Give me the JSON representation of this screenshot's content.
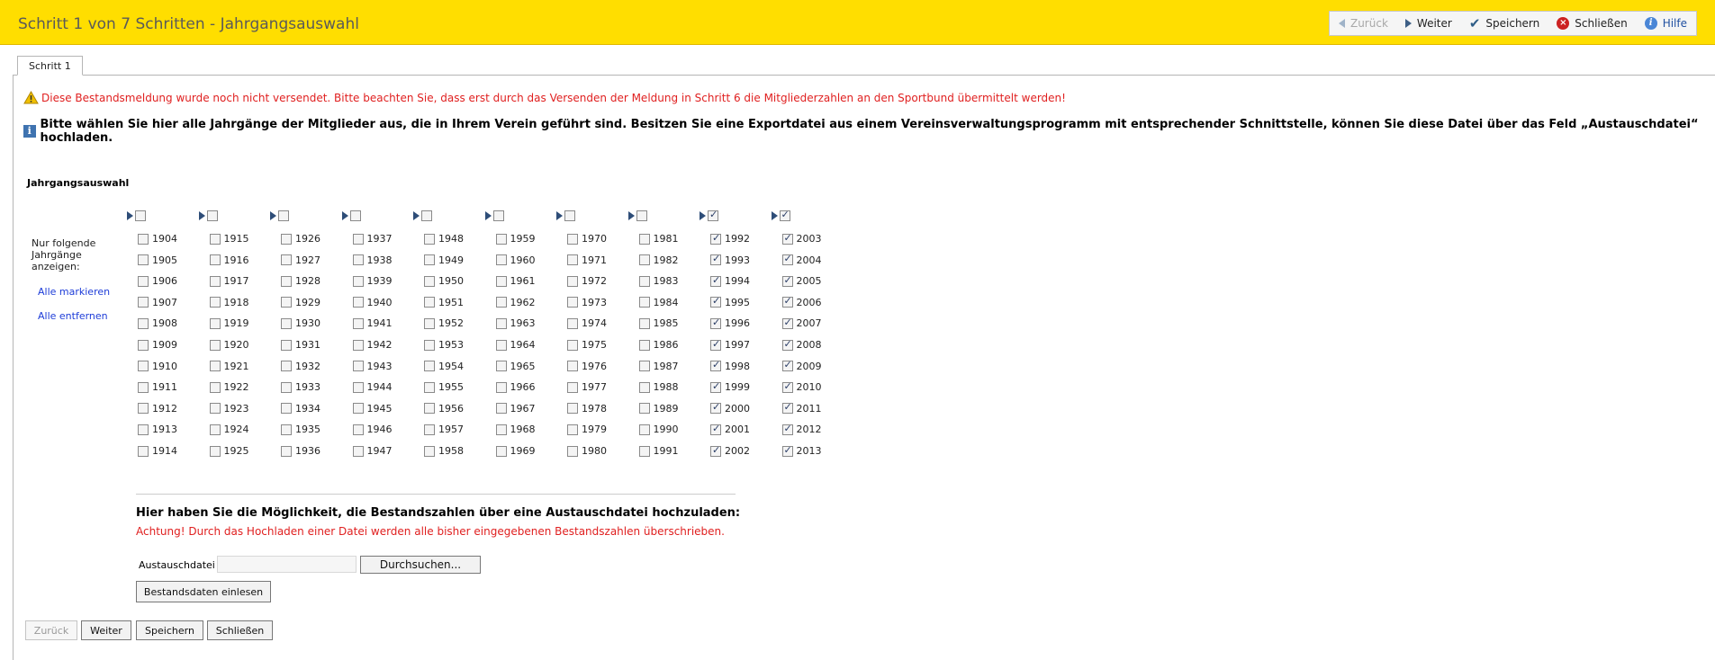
{
  "header": {
    "title": "Schritt 1 von 7 Schritten - Jahrgangsauswahl",
    "toolbar": {
      "back": "Zurück",
      "next": "Weiter",
      "save": "Speichern",
      "close": "Schließen",
      "help": "Hilfe"
    }
  },
  "tab": {
    "label": "Schritt 1"
  },
  "messages": {
    "warning": "Diese Bestandsmeldung wurde noch nicht versendet. Bitte beachten Sie, dass erst durch das Versenden der Meldung in Schritt 6 die Mitgliederzahlen an den Sportbund übermittelt werden!",
    "info": "Bitte wählen Sie hier alle Jahrgänge der Mitglieder aus, die in Ihrem Verein geführt sind. Besitzen Sie eine Exportdatei aus einem Vereinsverwaltungsprogramm mit entsprechender Schnittstelle, können Sie diese Datei über das Feld „Austauschdatei“ hochladen."
  },
  "selection": {
    "title": "Jahrgangsauswahl",
    "side_label": "Nur folgende Jahrgänge anzeigen:",
    "mark_all": "Alle markieren",
    "remove_all": "Alle entfernen",
    "columns": [
      {
        "checked": false,
        "years": [
          {
            "y": "1904",
            "c": false
          },
          {
            "y": "1905",
            "c": false
          },
          {
            "y": "1906",
            "c": false
          },
          {
            "y": "1907",
            "c": false
          },
          {
            "y": "1908",
            "c": false
          },
          {
            "y": "1909",
            "c": false
          },
          {
            "y": "1910",
            "c": false
          },
          {
            "y": "1911",
            "c": false
          },
          {
            "y": "1912",
            "c": false
          },
          {
            "y": "1913",
            "c": false
          },
          {
            "y": "1914",
            "c": false
          }
        ]
      },
      {
        "checked": false,
        "years": [
          {
            "y": "1915",
            "c": false
          },
          {
            "y": "1916",
            "c": false
          },
          {
            "y": "1917",
            "c": false
          },
          {
            "y": "1918",
            "c": false
          },
          {
            "y": "1919",
            "c": false
          },
          {
            "y": "1920",
            "c": false
          },
          {
            "y": "1921",
            "c": false
          },
          {
            "y": "1922",
            "c": false
          },
          {
            "y": "1923",
            "c": false
          },
          {
            "y": "1924",
            "c": false
          },
          {
            "y": "1925",
            "c": false
          }
        ]
      },
      {
        "checked": false,
        "years": [
          {
            "y": "1926",
            "c": false
          },
          {
            "y": "1927",
            "c": false
          },
          {
            "y": "1928",
            "c": false
          },
          {
            "y": "1929",
            "c": false
          },
          {
            "y": "1930",
            "c": false
          },
          {
            "y": "1931",
            "c": false
          },
          {
            "y": "1932",
            "c": false
          },
          {
            "y": "1933",
            "c": false
          },
          {
            "y": "1934",
            "c": false
          },
          {
            "y": "1935",
            "c": false
          },
          {
            "y": "1936",
            "c": false
          }
        ]
      },
      {
        "checked": false,
        "years": [
          {
            "y": "1937",
            "c": false
          },
          {
            "y": "1938",
            "c": false
          },
          {
            "y": "1939",
            "c": false
          },
          {
            "y": "1940",
            "c": false
          },
          {
            "y": "1941",
            "c": false
          },
          {
            "y": "1942",
            "c": false
          },
          {
            "y": "1943",
            "c": false
          },
          {
            "y": "1944",
            "c": false
          },
          {
            "y": "1945",
            "c": false
          },
          {
            "y": "1946",
            "c": false
          },
          {
            "y": "1947",
            "c": false
          }
        ]
      },
      {
        "checked": false,
        "years": [
          {
            "y": "1948",
            "c": false
          },
          {
            "y": "1949",
            "c": false
          },
          {
            "y": "1950",
            "c": false
          },
          {
            "y": "1951",
            "c": false
          },
          {
            "y": "1952",
            "c": false
          },
          {
            "y": "1953",
            "c": false
          },
          {
            "y": "1954",
            "c": false
          },
          {
            "y": "1955",
            "c": false
          },
          {
            "y": "1956",
            "c": false
          },
          {
            "y": "1957",
            "c": false
          },
          {
            "y": "1958",
            "c": false
          }
        ]
      },
      {
        "checked": false,
        "years": [
          {
            "y": "1959",
            "c": false
          },
          {
            "y": "1960",
            "c": false
          },
          {
            "y": "1961",
            "c": false
          },
          {
            "y": "1962",
            "c": false
          },
          {
            "y": "1963",
            "c": false
          },
          {
            "y": "1964",
            "c": false
          },
          {
            "y": "1965",
            "c": false
          },
          {
            "y": "1966",
            "c": false
          },
          {
            "y": "1967",
            "c": false
          },
          {
            "y": "1968",
            "c": false
          },
          {
            "y": "1969",
            "c": false
          }
        ]
      },
      {
        "checked": false,
        "years": [
          {
            "y": "1970",
            "c": false
          },
          {
            "y": "1971",
            "c": false
          },
          {
            "y": "1972",
            "c": false
          },
          {
            "y": "1973",
            "c": false
          },
          {
            "y": "1974",
            "c": false
          },
          {
            "y": "1975",
            "c": false
          },
          {
            "y": "1976",
            "c": false
          },
          {
            "y": "1977",
            "c": false
          },
          {
            "y": "1978",
            "c": false
          },
          {
            "y": "1979",
            "c": false
          },
          {
            "y": "1980",
            "c": false
          }
        ]
      },
      {
        "checked": false,
        "years": [
          {
            "y": "1981",
            "c": false
          },
          {
            "y": "1982",
            "c": false
          },
          {
            "y": "1983",
            "c": false
          },
          {
            "y": "1984",
            "c": false
          },
          {
            "y": "1985",
            "c": false
          },
          {
            "y": "1986",
            "c": false
          },
          {
            "y": "1987",
            "c": false
          },
          {
            "y": "1988",
            "c": false
          },
          {
            "y": "1989",
            "c": false
          },
          {
            "y": "1990",
            "c": false
          },
          {
            "y": "1991",
            "c": false
          }
        ]
      },
      {
        "checked": true,
        "years": [
          {
            "y": "1992",
            "c": true
          },
          {
            "y": "1993",
            "c": true
          },
          {
            "y": "1994",
            "c": true
          },
          {
            "y": "1995",
            "c": true
          },
          {
            "y": "1996",
            "c": true
          },
          {
            "y": "1997",
            "c": true
          },
          {
            "y": "1998",
            "c": true
          },
          {
            "y": "1999",
            "c": true
          },
          {
            "y": "2000",
            "c": true
          },
          {
            "y": "2001",
            "c": true
          },
          {
            "y": "2002",
            "c": true
          }
        ]
      },
      {
        "checked": true,
        "years": [
          {
            "y": "2003",
            "c": true
          },
          {
            "y": "2004",
            "c": true
          },
          {
            "y": "2005",
            "c": true
          },
          {
            "y": "2006",
            "c": true
          },
          {
            "y": "2007",
            "c": true
          },
          {
            "y": "2008",
            "c": true
          },
          {
            "y": "2009",
            "c": true
          },
          {
            "y": "2010",
            "c": true
          },
          {
            "y": "2011",
            "c": true
          },
          {
            "y": "2012",
            "c": true
          },
          {
            "y": "2013",
            "c": true
          }
        ]
      }
    ]
  },
  "upload": {
    "title": "Hier haben Sie die Möglichkeit, die Bestandszahlen über eine Austauschdatei hochzuladen:",
    "warning": "Achtung! Durch das Hochladen einer Datei werden alle bisher eingegebenen Bestandszahlen überschrieben.",
    "field_label": "Austauschdatei",
    "file_value": "",
    "browse_button": "Durchsuchen...",
    "import_button": "Bestandsdaten einlesen"
  },
  "footer": {
    "back": "Zurück",
    "next": "Weiter",
    "save": "Speichern",
    "close": "Schließen"
  },
  "colors": {
    "header_bg": "#ffde00",
    "warning_text": "#e02020",
    "link": "#1d3cd8"
  }
}
